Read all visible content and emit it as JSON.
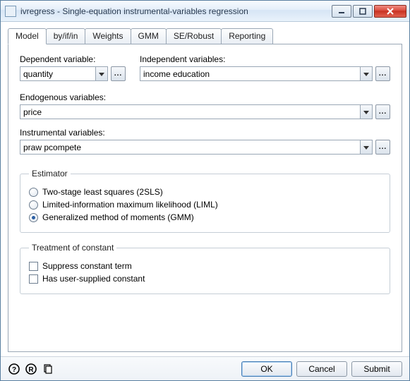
{
  "window": {
    "title": "ivregress - Single-equation instrumental-variables regression"
  },
  "tabs": [
    "Model",
    "by/if/in",
    "Weights",
    "GMM",
    "SE/Robust",
    "Reporting"
  ],
  "active_tab": 0,
  "labels": {
    "depvar": "Dependent variable:",
    "indepvars": "Independent variables:",
    "endog": "Endogenous variables:",
    "instr": "Instrumental variables:"
  },
  "fields": {
    "depvar": "quantity",
    "indepvars": "income education",
    "endog": "price",
    "instr": "praw pcompete"
  },
  "estimator": {
    "legend": "Estimator",
    "options": [
      "Two-stage least squares (2SLS)",
      "Limited-information maximum likelihood (LIML)",
      "Generalized method of moments (GMM)"
    ],
    "selected": 2
  },
  "constant": {
    "legend": "Treatment of constant",
    "options": [
      "Suppress constant term",
      "Has user-supplied constant"
    ]
  },
  "buttons": {
    "ok": "OK",
    "cancel": "Cancel",
    "submit": "Submit",
    "ellipsis": "..."
  }
}
